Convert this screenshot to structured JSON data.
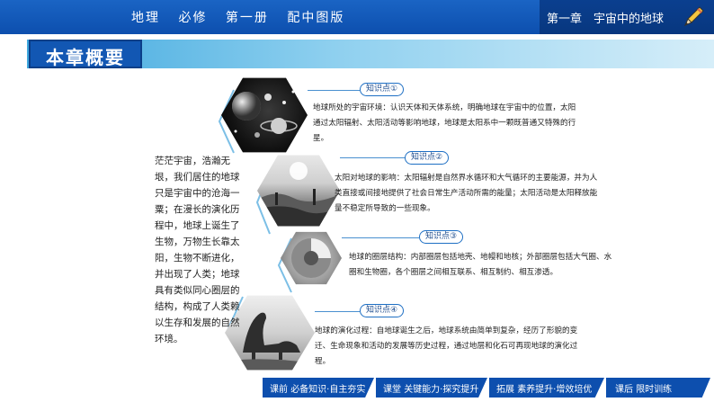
{
  "header": {
    "book_parts": [
      "地理",
      "必修",
      "第一册",
      "配中图版"
    ],
    "chapter": "第一章　宇宙中的地球"
  },
  "title": "本章概要",
  "intro": "茫茫宇宙，浩瀚无垠，我们居住的地球只是宇宙中的沧海一粟；在漫长的演化历程中，地球上诞生了生物，万物生长靠太阳，生物不断进化，并出现了人类；地球具有类似同心圈层的结构，构成了人类赖以生存和发展的自然环境。",
  "knowledge": [
    {
      "label": "知识点①",
      "text": "地球所处的宇宙环境：认识天体和天体系统，明确地球在宇宙中的位置，太阳通过太阳辐射、太阳活动等影响地球，地球是太阳系中一颗既普通又特殊的行星。"
    },
    {
      "label": "知识点②",
      "text": "太阳对地球的影响：太阳辐射是自然界水循环和大气循环的主要能源，并为人类直接或间接地提供了社会日常生产活动所需的能量；太阳活动是太阳释放能量不稳定所导致的一些现象。"
    },
    {
      "label": "知识点③",
      "text": "地球的圈层结构：内部圈层包括地壳、地幔和地核；外部圈层包括大气圈、水圈和生物圈，各个圈层之间相互联系、相互制约、相互渗透。"
    },
    {
      "label": "知识点④",
      "text": "地球的演化过程：自地球诞生之后，地球系统由简单到复杂，经历了形貌的变迁、生命现象和活动的发展等历史过程，通过地层和化石可再现地球的演化过程。"
    }
  ],
  "nav": [
    {
      "main": "课前",
      "sub": "必备知识·自主夯实"
    },
    {
      "main": "课堂",
      "sub": "关键能力·探究提升"
    },
    {
      "main": "拓展",
      "sub": "素养提升·增效培优"
    },
    {
      "main": "课后",
      "sub": "限时训练"
    }
  ]
}
